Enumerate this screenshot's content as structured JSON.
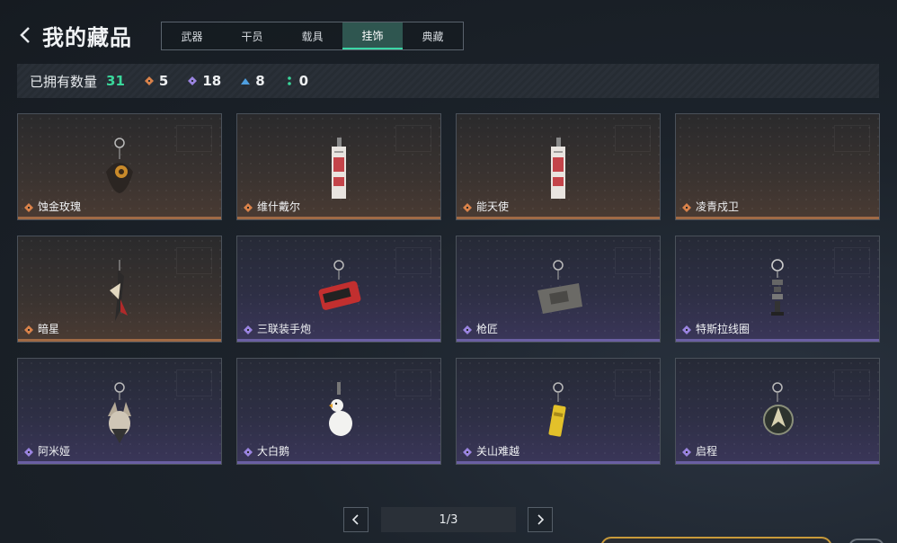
{
  "header": {
    "title": "我的藏品"
  },
  "tabs": [
    {
      "label": "武器",
      "active": false
    },
    {
      "label": "干员",
      "active": false
    },
    {
      "label": "载具",
      "active": false
    },
    {
      "label": "挂饰",
      "active": true
    },
    {
      "label": "典藏",
      "active": false
    }
  ],
  "owned": {
    "label": "已拥有数量",
    "total": "31",
    "stats": [
      {
        "icon": "orange-diamond-icon",
        "value": "5",
        "color": "#d9824a"
      },
      {
        "icon": "purple-diamond-icon",
        "value": "18",
        "color": "#9a84e0"
      },
      {
        "icon": "blue-chevron-icon",
        "value": "8",
        "color": "#4f9fe0"
      },
      {
        "icon": "green-dots-icon",
        "value": "0",
        "color": "#3ad79b"
      }
    ]
  },
  "items": [
    {
      "name": "蚀金玫瑰",
      "rarity": "orange",
      "icon": "rose-charm-icon"
    },
    {
      "name": "维什戴尔",
      "rarity": "orange",
      "icon": "card-charm-icon"
    },
    {
      "name": "能天使",
      "rarity": "orange",
      "icon": "card-charm-icon"
    },
    {
      "name": "凌青戍卫",
      "rarity": "orange",
      "icon": "empty-charm-icon"
    },
    {
      "name": "暗星",
      "rarity": "orange",
      "icon": "blade-charm-icon"
    },
    {
      "name": "三联装手炮",
      "rarity": "purple",
      "icon": "cannon-charm-icon"
    },
    {
      "name": "枪匠",
      "rarity": "purple",
      "icon": "toolbox-charm-icon"
    },
    {
      "name": "特斯拉线圈",
      "rarity": "purple",
      "icon": "coil-charm-icon"
    },
    {
      "name": "阿米娅",
      "rarity": "purple",
      "icon": "bunny-charm-icon"
    },
    {
      "name": "大白鹅",
      "rarity": "purple",
      "icon": "goose-charm-icon"
    },
    {
      "name": "关山难越",
      "rarity": "purple",
      "icon": "can-charm-icon"
    },
    {
      "name": "启程",
      "rarity": "purple",
      "icon": "compass-charm-icon"
    }
  ],
  "pagination": {
    "indicator": "1/3"
  },
  "colors": {
    "accent": "#3ad7a6",
    "orange": "#d9824a",
    "purple": "#9a84e0"
  }
}
